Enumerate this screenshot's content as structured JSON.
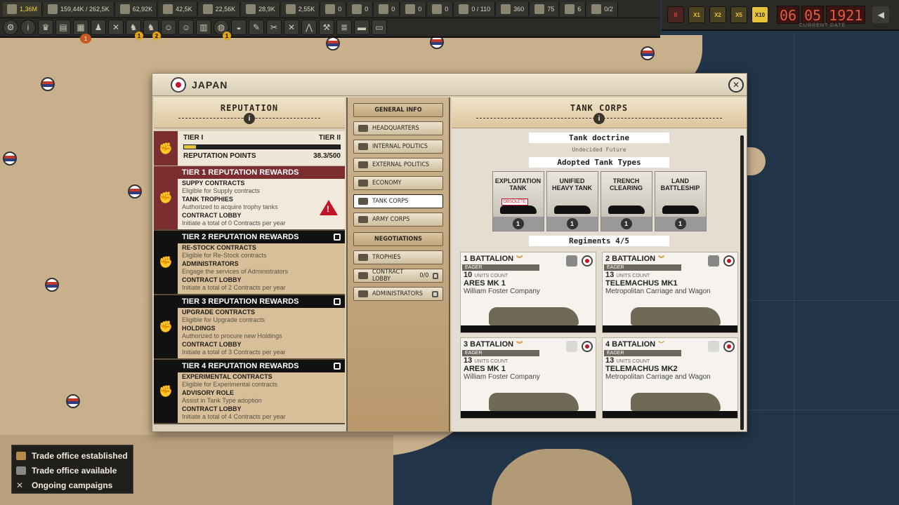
{
  "topbar": {
    "money": "1,36M",
    "resources": [
      {
        "icon": "coal-icon",
        "value": "159,44K / 262,5K"
      },
      {
        "icon": "steel-icon",
        "value": "62,92K"
      },
      {
        "icon": "oil-icon",
        "value": "42,5K"
      },
      {
        "icon": "rubber-icon",
        "value": "22,56K"
      },
      {
        "icon": "ammo-icon",
        "value": "28,9K"
      },
      {
        "icon": "parts-icon",
        "value": "2,55K"
      },
      {
        "icon": "crate-icon",
        "value": "0"
      },
      {
        "icon": "grain-icon",
        "value": "0"
      },
      {
        "icon": "fabric-icon",
        "value": "0"
      },
      {
        "icon": "chem-icon",
        "value": "0"
      },
      {
        "icon": "bag-icon",
        "value": "0"
      }
    ],
    "capacity": "0 / 110",
    "units": [
      {
        "icon": "soldier-icon",
        "value": "360"
      },
      {
        "icon": "officer-icon",
        "value": "75"
      },
      {
        "icon": "general-icon",
        "value": "6"
      }
    ],
    "buildings": "0/2",
    "badges": [
      "1",
      "2",
      "1"
    ],
    "red_badge": "1"
  },
  "time": {
    "speeds": [
      "II",
      "X1",
      "X2",
      "X5",
      "X10"
    ],
    "day": "06",
    "month": "05",
    "year": "1921",
    "date_label": "CURRENT DATE"
  },
  "panel": {
    "title": "JAPAN",
    "reputation": {
      "header": "REPUTATION",
      "tier_current": "TIER I",
      "tier_next": "TIER II",
      "points_label": "REPUTATION POINTS",
      "points_value": "38.3/500",
      "progress": 0.077,
      "rewards": [
        {
          "title": "TIER 1 REPUTATION REWARDS",
          "roman": "I",
          "items": [
            {
              "name": "SUPPY CONTRACTS",
              "desc": "Eligible for Supply contracts"
            },
            {
              "name": "TANK TROPHIES",
              "desc": "Authorized to acquire trophy tanks"
            },
            {
              "name": "CONTRACT LOBBY",
              "desc": "Initiate a total of 0 Contracts per year"
            }
          ]
        },
        {
          "title": "TIER 2 REPUTATION REWARDS",
          "roman": "II",
          "items": [
            {
              "name": "RE-STOCK CONTRACTS",
              "desc": "Eligible for Re-Stock contracts"
            },
            {
              "name": "ADMINISTRATORS",
              "desc": "Engage the services of Administrators"
            },
            {
              "name": "CONTRACT LOBBY",
              "desc": "Initiate a total of 2 Contracts per year"
            }
          ]
        },
        {
          "title": "TIER 3 REPUTATION REWARDS",
          "roman": "III",
          "items": [
            {
              "name": "UPGRADE CONTRACTS",
              "desc": "Eligible for Upgrade contracts"
            },
            {
              "name": "HOLDINGS",
              "desc": "Authorized to procure new Holdings"
            },
            {
              "name": "CONTRACT LOBBY",
              "desc": "Initiate a total of 3 Contracts per year"
            }
          ]
        },
        {
          "title": "TIER 4 REPUTATION REWARDS",
          "roman": "IV",
          "items": [
            {
              "name": "EXPERIMENTAL CONTRACTS",
              "desc": "Eligible for Experimental contracts"
            },
            {
              "name": "ADVISORY ROLE",
              "desc": "Assist in Tank Type adoption"
            },
            {
              "name": "CONTRACT LOBBY",
              "desc": "Initiate a total of 4 Contracts per year"
            }
          ]
        }
      ]
    },
    "nav": {
      "general_info": "GENERAL INFO",
      "headquarters": "HEADQUARTERS",
      "internal_politics": "INTERNAL POLITICS",
      "external_politics": "EXTERNAL POLITICS",
      "economy": "ECONOMY",
      "tank_corps": "TANK CORPS",
      "army_corps": "ARMY CORPS",
      "negotiations": "NEGOTIATIONS",
      "trophies": "TROPHIES",
      "contract_lobby": "CONTRACT LOBBY",
      "contract_lobby_count": "0/0",
      "administrators": "ADMINISTRATORS"
    },
    "tank_corps": {
      "header": "TANK CORPS",
      "doctrine_label": "Tank doctrine",
      "doctrine_value": "Undecided Future",
      "adopted_label": "Adopted Tank Types",
      "types": [
        {
          "line1": "EXPLOITATION",
          "line2": "TANK",
          "obsolete": "OBSOLETE",
          "count": "1"
        },
        {
          "line1": "UNIFIED",
          "line2": "HEAVY TANK",
          "obsolete": "",
          "count": "1"
        },
        {
          "line1": "TRENCH",
          "line2": "CLEARING",
          "obsolete": "",
          "count": "1"
        },
        {
          "line1": "LAND",
          "line2": "BATTLESHIP",
          "obsolete": "",
          "count": "1"
        }
      ],
      "regiments_label": "Regiments 4/5",
      "units_count_label": "UNITS COUNT",
      "battalions": [
        {
          "name": "1 BATTALION",
          "morale": "EAGER",
          "count": "10",
          "model": "ARES MK 1",
          "maker": "William Foster Company"
        },
        {
          "name": "2 BATTALION",
          "morale": "EAGER",
          "count": "13",
          "model": "TELEMACHUS MK1",
          "maker": "Metropolitan Carriage and Wagon"
        },
        {
          "name": "3 BATTALION",
          "morale": "EAGER",
          "count": "13",
          "model": "ARES MK 1",
          "maker": "William Foster Company"
        },
        {
          "name": "4 BATTALION",
          "morale": "EAGER",
          "count": "13",
          "model": "TELEMACHUS MK2",
          "maker": "Metropolitan Carriage and Wagon"
        }
      ]
    }
  },
  "legend": {
    "items": [
      "Trade office established",
      "Trade office available",
      "Ongoing campaigns"
    ]
  }
}
